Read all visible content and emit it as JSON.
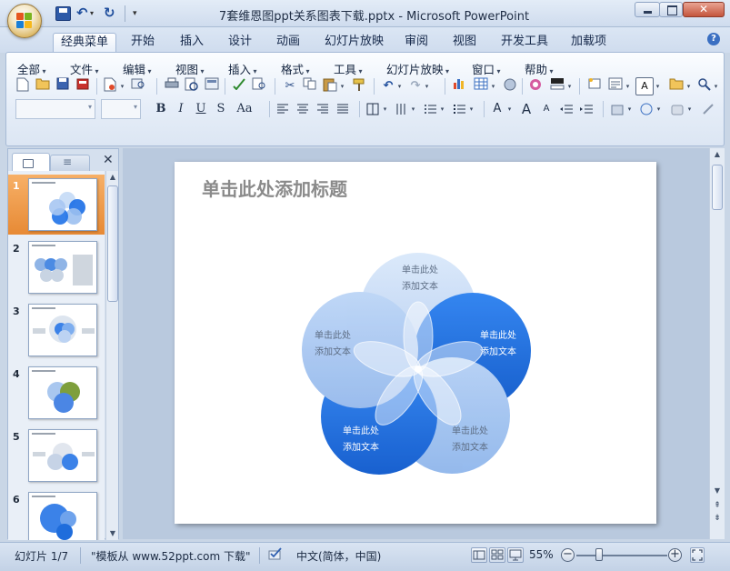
{
  "window": {
    "title": "7套维恩图ppt关系图表下载.pptx - Microsoft PowerPoint"
  },
  "quick_access": {
    "save_label": "Save",
    "undo_label": "Undo",
    "redo_label": "Redo"
  },
  "tabs": [
    {
      "label": "经典菜单",
      "active": true
    },
    {
      "label": "开始"
    },
    {
      "label": "插入"
    },
    {
      "label": "设计"
    },
    {
      "label": "动画"
    },
    {
      "label": "幻灯片放映"
    },
    {
      "label": "审阅"
    },
    {
      "label": "视图"
    },
    {
      "label": "开发工具"
    },
    {
      "label": "加载项"
    }
  ],
  "classic_menu": [
    "全部",
    "文件",
    "编辑",
    "视图",
    "插入",
    "格式",
    "工具",
    "幻灯片放映",
    "窗口",
    "帮助"
  ],
  "format_toolbar": {
    "bold": "B",
    "italic": "I",
    "underline": "U",
    "shadow": "S",
    "change_case": "Aa",
    "font_grow": "A",
    "font_shrink": "A",
    "text_box": "A"
  },
  "slide_panel": {
    "thumbnails": [
      {
        "num": "1",
        "selected": true
      },
      {
        "num": "2"
      },
      {
        "num": "3"
      },
      {
        "num": "4"
      },
      {
        "num": "5"
      },
      {
        "num": "6"
      }
    ]
  },
  "slide": {
    "title_placeholder": "单击此处添加标题",
    "petals": [
      {
        "line1": "单击此处",
        "line2": "添加文本",
        "color": "#c7dcf7"
      },
      {
        "line1": "单击此处",
        "line2": "添加文本",
        "color": "#1b6ee6"
      },
      {
        "line1": "单击此处",
        "line2": "添加文本",
        "color": "#9cc0f0"
      },
      {
        "line1": "单击此处",
        "line2": "添加文本",
        "color": "#1f72e8"
      },
      {
        "line1": "单击此处",
        "line2": "添加文本",
        "color": "#a7c6f2"
      }
    ]
  },
  "status": {
    "slide_counter": "幻灯片 1/7",
    "template": "\"模板从 www.52ppt.com 下载\"",
    "language": "中文(简体，中国)",
    "zoom": "55%",
    "zoom_value": 55
  },
  "colors": {
    "accent": "#1b6ee6",
    "selection": "#e78a35",
    "ribbon": "#dce6f3"
  }
}
